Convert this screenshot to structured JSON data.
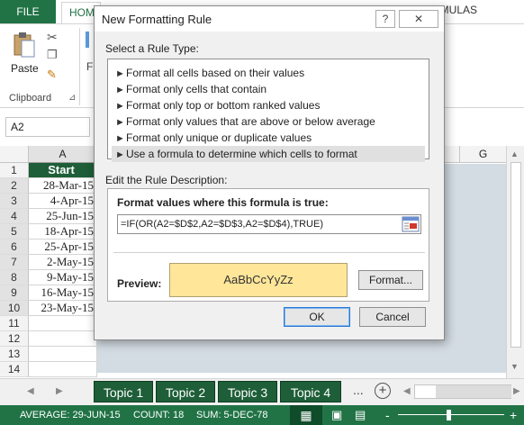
{
  "ribbon": {
    "file_tab": "FILE",
    "home_tab": "HOME",
    "formulas_tab": "RMULAS",
    "paste_label": "Paste",
    "clipboard_label": "Clipboard",
    "font_group_letter": "F",
    "icons": [
      "paste-icon",
      "cut-icon",
      "copy-icon",
      "format-painter-icon"
    ]
  },
  "formula_bar": {
    "name_box": "A2"
  },
  "grid": {
    "columns": {
      "a": "A",
      "g": "G"
    },
    "row_numbers": [
      "1",
      "2",
      "3",
      "4",
      "5",
      "6",
      "7",
      "8",
      "9",
      "10",
      "11",
      "12",
      "13",
      "14"
    ],
    "header_cell": "Start",
    "cells": [
      "28-Mar-15",
      "4-Apr-15",
      "25-Jun-15",
      "18-Apr-15",
      "25-Apr-15",
      "2-May-15",
      "9-May-15",
      "16-May-15",
      "23-May-15"
    ]
  },
  "sheets": {
    "tabs": [
      "Topic 1",
      "Topic 2",
      "Topic 3",
      "Topic 4"
    ],
    "more": "...",
    "add": "+"
  },
  "status": {
    "average": "AVERAGE: 29-JUN-15",
    "count": "COUNT: 18",
    "sum": "SUM: 5-DEC-78",
    "zoom_minus": "-",
    "zoom_plus": "+"
  },
  "dialog": {
    "title": "New Formatting Rule",
    "help": "?",
    "close": "✕",
    "rule_type_label": "Select a Rule Type:",
    "rule_types": [
      "Format all cells based on their values",
      "Format only cells that contain",
      "Format only top or bottom ranked values",
      "Format only values that are above or below average",
      "Format only unique or duplicate values",
      "Use a formula to determine which cells to format"
    ],
    "selected_rule_index": 5,
    "edit_label": "Edit the Rule Description:",
    "formula_label": "Format values where this formula is true:",
    "formula_value": "=IF(OR(A2=$D$2,A2=$D$3,A2=$D$4),TRUE)",
    "preview_label": "Preview:",
    "preview_text": "AaBbCcYyZz",
    "preview_fill": "#ffe699",
    "format_button": "Format...",
    "ok_button": "OK",
    "cancel_button": "Cancel"
  },
  "colors": {
    "excel_green": "#217346",
    "header_green": "#1e5e38",
    "grid_overlay": "#d3dbe3"
  }
}
